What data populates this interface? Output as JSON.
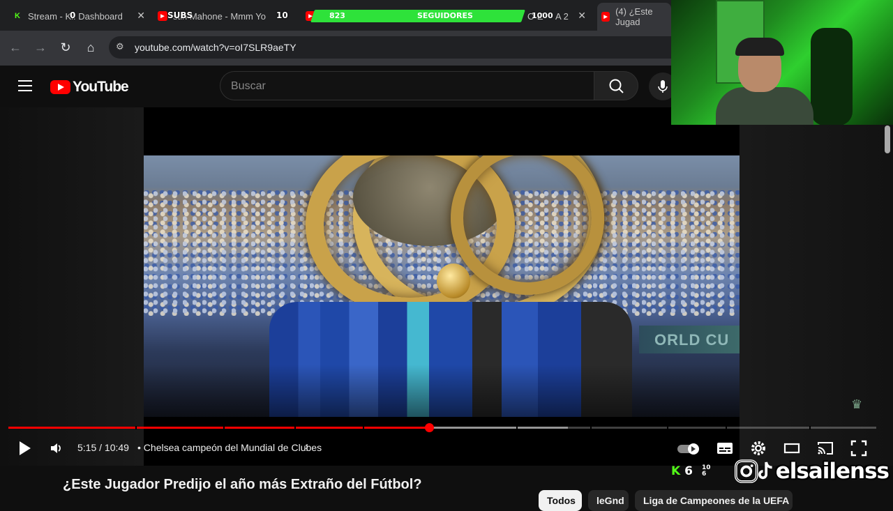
{
  "browser": {
    "tabs": [
      {
        "label": "Stream - Ki",
        "suffix": ": Dashboard",
        "favicon": "kick-icon"
      },
      {
        "label": "stin Mahone - Mmm Yo",
        "favicon": "youtube-icon"
      },
      {
        "label": "O E",
        "trail": "A 2",
        "favicon": "youtube-icon"
      },
      {
        "label": "(4) ¿Este Jugad",
        "favicon": "youtube-icon"
      }
    ],
    "url": "youtube.com/watch?v=oI7SLR9aeTY"
  },
  "stream_overlay": {
    "subs_label": "SUBS",
    "subs_start": "0",
    "subs_goal": "10",
    "followers_count": "823",
    "followers_label": "SEGUIDORES",
    "followers_goal": "1000",
    "kick_count": "6",
    "mini_top": "10",
    "mini_bottom": "6",
    "tiktok_handle": "elsailenss"
  },
  "youtube": {
    "logo_text": "YouTube",
    "search_placeholder": "Buscar",
    "player": {
      "current_time": "5:15",
      "duration": "10:49",
      "time_display": "5:15 / 10:49",
      "chapter_separator": "•",
      "chapter_title": "Chelsea campeón del Mundial de Clubes",
      "progress_fraction": 0.485,
      "buffer_fraction": 0.645,
      "banner_text": "ORLD CU"
    },
    "video_title": "¿Este Jugador Predijo el año más Extraño del Fútbol?",
    "chips": [
      {
        "label": "Todos",
        "active": true
      },
      {
        "label": "leGnd",
        "active": false
      },
      {
        "label": "Liga de Campeones de la UEFA",
        "active": false
      }
    ]
  },
  "colors": {
    "youtube_red": "#ff0000",
    "kick_green": "#53fc18",
    "followers_bar": "#2ee23a",
    "background": "#0f0f0f"
  }
}
